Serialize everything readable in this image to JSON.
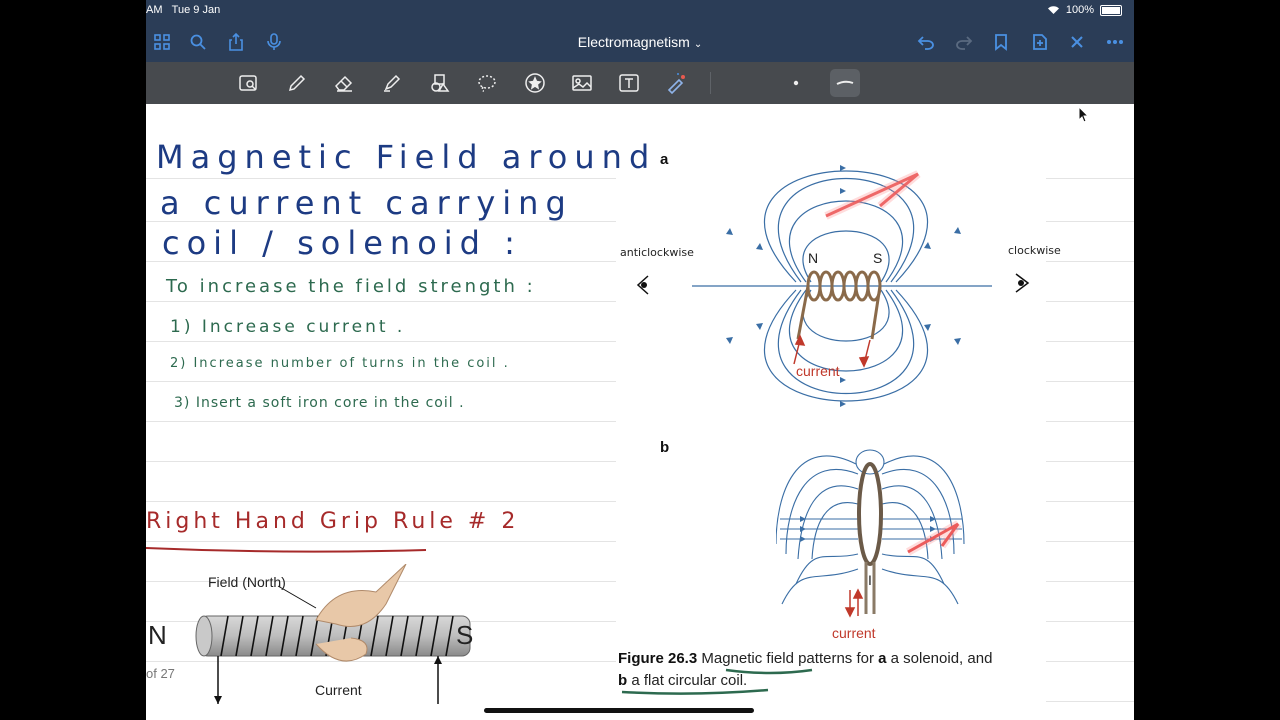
{
  "status": {
    "time": "AM",
    "date": "Tue 9 Jan",
    "battery": "100%"
  },
  "nav": {
    "title": "Electromagnetism"
  },
  "icons": {
    "left": [
      "grid-icon",
      "search-icon",
      "share-icon",
      "microphone-icon"
    ],
    "right": [
      "undo-icon",
      "redo-icon",
      "bookmark-icon",
      "add-page-icon",
      "close-icon",
      "more-icon"
    ],
    "tools": [
      "lasso-zoom-icon",
      "pen-icon",
      "eraser-icon",
      "highlighter-icon",
      "shapes-icon",
      "lasso-icon",
      "sticker-icon",
      "image-icon",
      "text-icon",
      "laser-pointer-icon"
    ]
  },
  "notes": {
    "title_lines": [
      "Magnetic Field around",
      "a  current carrying",
      "coil / solenoid :"
    ],
    "subtitle": "To  increase  the  field  strength :",
    "points": [
      "1)   Increase   current .",
      "2)   Increase   number  of  turns  in   the   coil .",
      "3)  Insert  a  soft  iron core  in the  coil ."
    ],
    "rule_heading": "Right Hand Grip Rule # 2"
  },
  "grip_diagram": {
    "north": "N",
    "south": "S",
    "field_label": "Field (North)",
    "current_label": "Current"
  },
  "figure": {
    "label_a": "a",
    "label_b": "b",
    "anticlockwise": "anticlockwise",
    "clockwise": "clockwise",
    "n": "N",
    "s": "S",
    "current_a": "current",
    "current_b": "current",
    "i_label": "I",
    "caption_num": "Figure 26.3",
    "caption_text": " Magnetic field patterns for ",
    "caption_a_bold": "a",
    "caption_a_text": " a solenoid",
    "caption_mid": ", and",
    "caption_b_bold": "b",
    "caption_b_text": " a flat circular coil."
  },
  "page_number": "of 27",
  "colors": {
    "bar": "#2b3d57",
    "toolbar": "#474a4e",
    "navy_ink": "#1d3b83",
    "green_ink": "#2d6a4f",
    "red_ink": "#a62a2a",
    "field_line": "#3a6ea5"
  }
}
